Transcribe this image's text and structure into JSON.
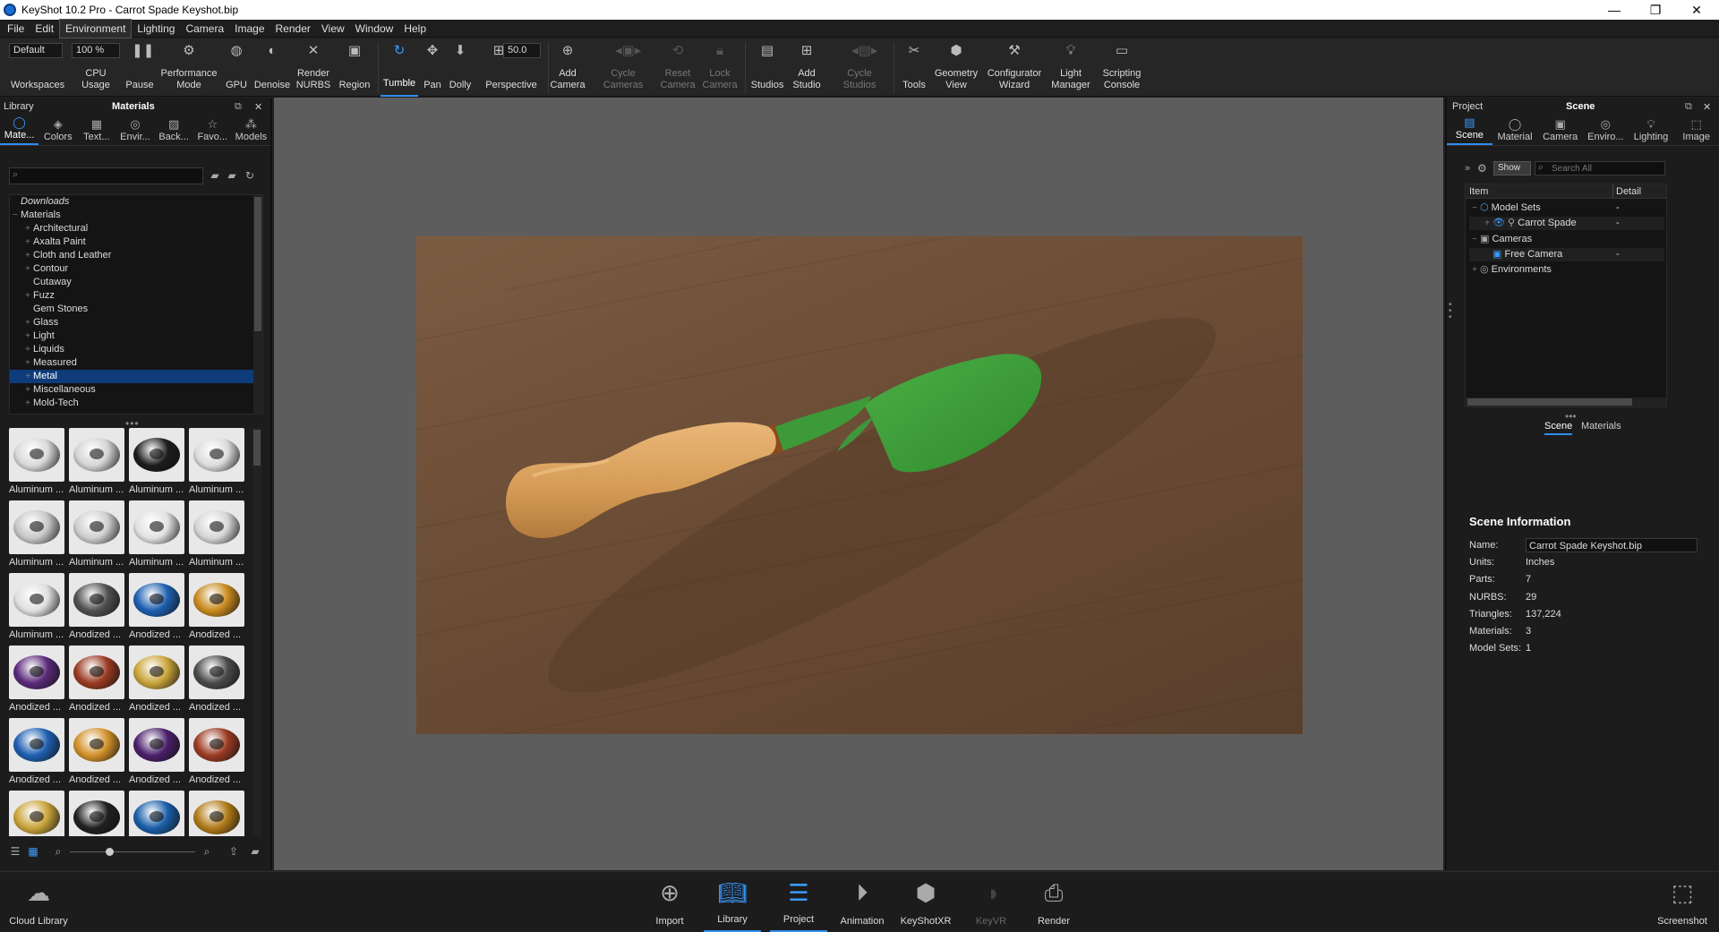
{
  "window": {
    "title": "KeyShot 10.2 Pro  - Carrot Spade Keyshot.bip",
    "minimize": "—",
    "restore": "❐",
    "close": "✕"
  },
  "menu": [
    "File",
    "Edit",
    "Environment",
    "Lighting",
    "Camera",
    "Image",
    "Render",
    "View",
    "Window",
    "Help"
  ],
  "toolbar": {
    "workspace_value": "Default",
    "cpu_value": "100 %",
    "fov_value": "50.0",
    "items": {
      "workspaces": "Workspaces",
      "cpu": "CPU Usage",
      "pause": "Pause",
      "performance": "Performance Mode",
      "gpu": "GPU",
      "denoise": "Denoise",
      "render_nurbs": "Render NURBS",
      "region": "Region",
      "tumble": "Tumble",
      "pan": "Pan",
      "dolly": "Dolly",
      "perspective": "Perspective",
      "add_camera": "Add Camera",
      "cycle_cameras": "Cycle Cameras",
      "reset_camera": "Reset Camera",
      "lock_camera": "Lock Camera",
      "studios": "Studios",
      "add_studio": "Add Studio",
      "cycle_studios": "Cycle Studios",
      "tools": "Tools",
      "geometry_view": "Geometry View",
      "configurator_wizard": "Configurator Wizard",
      "light_manager": "Light Manager",
      "scripting_console": "Scripting Console"
    }
  },
  "library": {
    "panel_label": "Library",
    "title": "Materials",
    "tabs": [
      "Mate...",
      "Colors",
      "Text...",
      "Envir...",
      "Back...",
      "Favo...",
      "Models"
    ],
    "tree": [
      {
        "label": "Downloads",
        "italic": true
      },
      {
        "label": "Materials",
        "expander": "−"
      },
      {
        "label": "Architectural",
        "expander": "+"
      },
      {
        "label": "Axalta Paint",
        "expander": "+"
      },
      {
        "label": "Cloth and Leather",
        "expander": "+"
      },
      {
        "label": "Contour",
        "expander": "+"
      },
      {
        "label": "Cutaway",
        "expander": ""
      },
      {
        "label": "Fuzz",
        "expander": "+"
      },
      {
        "label": "Gem Stones",
        "expander": ""
      },
      {
        "label": "Glass",
        "expander": "+"
      },
      {
        "label": "Light",
        "expander": "+"
      },
      {
        "label": "Liquids",
        "expander": "+"
      },
      {
        "label": "Measured",
        "expander": "+"
      },
      {
        "label": "Metal",
        "expander": "+",
        "selected": true
      },
      {
        "label": "Miscellaneous",
        "expander": "+"
      },
      {
        "label": "Mold-Tech",
        "expander": "+"
      }
    ],
    "thumbs": [
      {
        "label": "Aluminum ...",
        "color": "#d9d9d9"
      },
      {
        "label": "Aluminum ...",
        "color": "#d4d4d4"
      },
      {
        "label": "Aluminum ...",
        "color": "#1c1c1c"
      },
      {
        "label": "Aluminum ...",
        "color": "#dcdcdc"
      },
      {
        "label": "Aluminum ...",
        "color": "#c8c8c8"
      },
      {
        "label": "Aluminum ...",
        "color": "#cfcfcf"
      },
      {
        "label": "Aluminum ...",
        "color": "#e2e2e2"
      },
      {
        "label": "Aluminum ...",
        "color": "#d6d6d6"
      },
      {
        "label": "Aluminum ...",
        "color": "#e0e0e0"
      },
      {
        "label": "Anodized ...",
        "color": "#505050"
      },
      {
        "label": "Anodized ...",
        "color": "#1e5fb0"
      },
      {
        "label": "Anodized ...",
        "color": "#c88a1e"
      },
      {
        "label": "Anodized ...",
        "color": "#5a2a7a"
      },
      {
        "label": "Anodized ...",
        "color": "#9a3a22"
      },
      {
        "label": "Anodized ...",
        "color": "#c9a43a"
      },
      {
        "label": "Anodized ...",
        "color": "#4a4a4a"
      },
      {
        "label": "Anodized ...",
        "color": "#1e5fb0"
      },
      {
        "label": "Anodized ...",
        "color": "#d1902a"
      },
      {
        "label": "Anodized ...",
        "color": "#4a1f6a"
      },
      {
        "label": "Anodized ...",
        "color": "#9a3a22"
      },
      {
        "label": "",
        "color": "#c9a43a"
      },
      {
        "label": "",
        "color": "#202020"
      },
      {
        "label": "",
        "color": "#1a5ea8"
      },
      {
        "label": "",
        "color": "#b07a18"
      }
    ]
  },
  "project": {
    "panel_label": "Project",
    "title": "Scene",
    "tabs": [
      "Scene",
      "Material",
      "Camera",
      "Enviro...",
      "Lighting",
      "Image"
    ],
    "show_button": "Show",
    "search_placeholder": "Search All",
    "col_item": "Item",
    "col_detail": "Detail",
    "tree": [
      {
        "label": "Model Sets",
        "detail": "-"
      },
      {
        "label": "Carrot Spade",
        "detail": "-"
      },
      {
        "label": "Cameras",
        "detail": ""
      },
      {
        "label": "Free Camera",
        "detail": "-"
      },
      {
        "label": "Environments",
        "detail": ""
      }
    ],
    "subtabs": [
      "Scene",
      "Materials"
    ],
    "info_title": "Scene Information",
    "info": [
      {
        "k": "Name:",
        "v": "Carrot Spade Keyshot.bip"
      },
      {
        "k": "Units:",
        "v": "Inches"
      },
      {
        "k": "Parts:",
        "v": "7"
      },
      {
        "k": "NURBS:",
        "v": "29"
      },
      {
        "k": "Triangles:",
        "v": "137,224"
      },
      {
        "k": "Materials:",
        "v": "3"
      },
      {
        "k": "Model Sets:",
        "v": "1"
      }
    ]
  },
  "bottom": {
    "cloud_library": "Cloud Library",
    "import": "Import",
    "library": "Library",
    "project": "Project",
    "animation": "Animation",
    "keyshotxr": "KeyShotXR",
    "keyvr": "KeyVR",
    "render": "Render",
    "screenshot": "Screenshot"
  },
  "colors": {
    "accent": "#2f8cf0",
    "selected_row": "#0e3c7a",
    "handle": "#d8a05e",
    "blade": "#3e9a3a"
  }
}
